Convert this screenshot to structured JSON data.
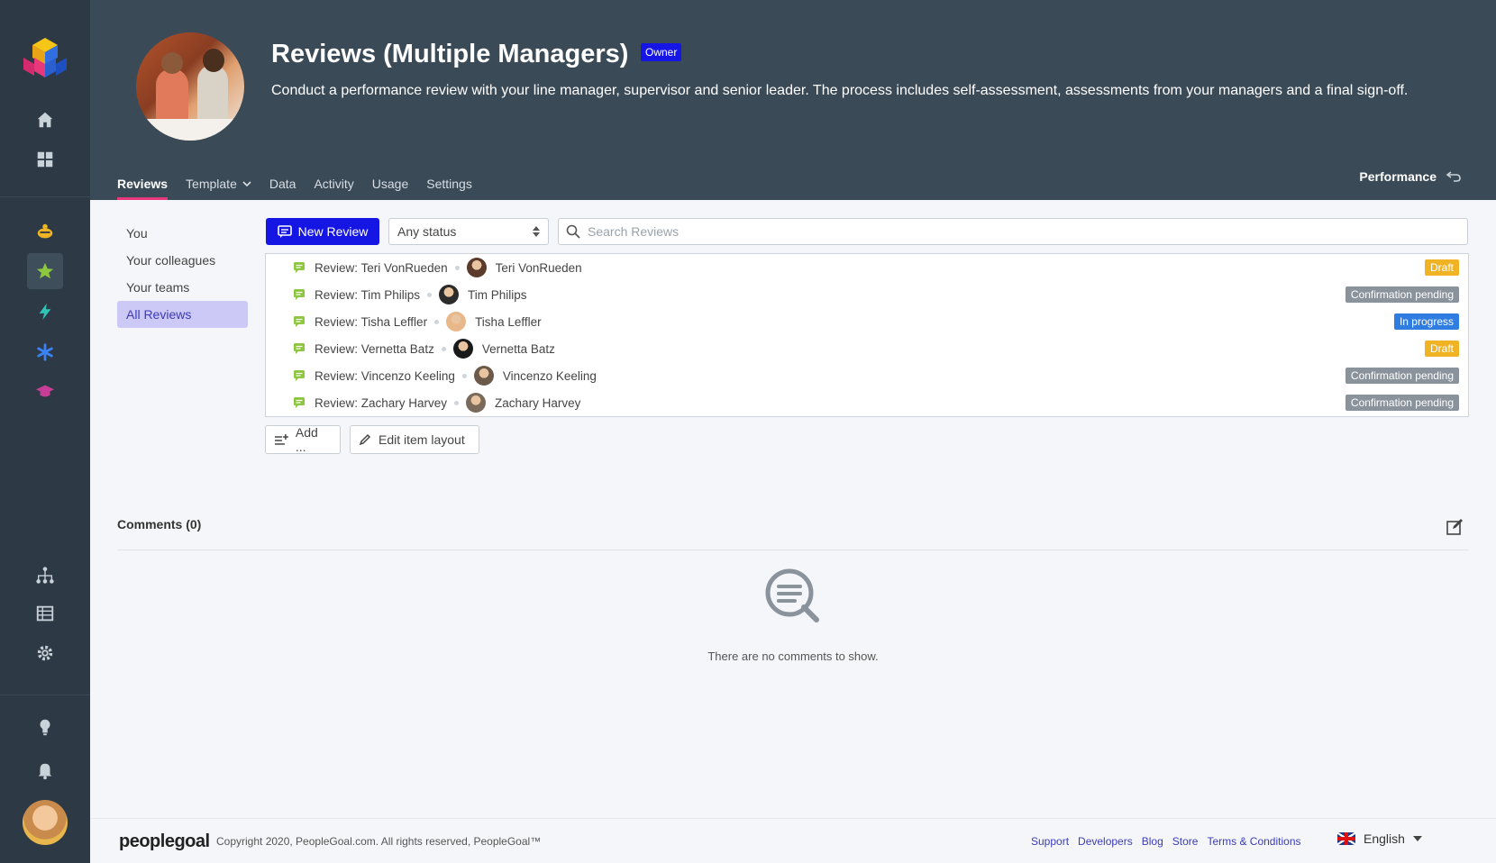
{
  "sidebar": {
    "icons": [
      "logo-icon",
      "home-icon",
      "apps-grid-icon",
      "bee-icon",
      "star-icon",
      "bolt-icon",
      "asterisk-icon",
      "graduation-cap-icon",
      "org-chart-icon",
      "table-icon",
      "gear-icon",
      "lightbulb-icon",
      "bell-icon"
    ],
    "colors": {
      "bg": "#2d3a46",
      "star": "#8dc63f",
      "bolt": "#2ec4b6",
      "asterisk": "#3b82f6",
      "cap": "#c83e96",
      "bee": "#f0b323"
    }
  },
  "header": {
    "title": "Reviews (Multiple Managers)",
    "owner_badge": "Owner",
    "description": "Conduct a performance review with your line manager, supervisor and senior leader. The process includes self-assessment, assessments from your managers and a final sign-off.",
    "tabs": [
      {
        "label": "Reviews",
        "active": true
      },
      {
        "label": "Template",
        "dropdown": true
      },
      {
        "label": "Data"
      },
      {
        "label": "Activity"
      },
      {
        "label": "Usage"
      },
      {
        "label": "Settings"
      }
    ],
    "performance_link": "Performance"
  },
  "subnav": {
    "items": [
      {
        "label": "You"
      },
      {
        "label": "Your colleagues"
      },
      {
        "label": "Your teams"
      },
      {
        "label": "All Reviews",
        "active": true
      }
    ]
  },
  "toolbar": {
    "new_review_label": "New Review",
    "status_select_value": "Any status",
    "search_placeholder": "Search Reviews"
  },
  "reviews": [
    {
      "title": "Review: Teri VonRueden",
      "person": "Teri VonRueden",
      "status": "Draft",
      "status_type": "draft",
      "avatar_color": "#5a3a2a"
    },
    {
      "title": "Review: Tim Philips",
      "person": "Tim Philips",
      "status": "Confirmation pending",
      "status_type": "pending",
      "avatar_color": "#2b2b2b"
    },
    {
      "title": "Review: Tisha Leffler",
      "person": "Tisha Leffler",
      "status": "In progress",
      "status_type": "progress",
      "avatar_color": "#e8b88a"
    },
    {
      "title": "Review: Vernetta Batz",
      "person": "Vernetta Batz",
      "status": "Draft",
      "status_type": "draft",
      "avatar_color": "#1a1a1a"
    },
    {
      "title": "Review: Vincenzo Keeling",
      "person": "Vincenzo Keeling",
      "status": "Confirmation pending",
      "status_type": "pending",
      "avatar_color": "#6b5a4a"
    },
    {
      "title": "Review: Zachary Harvey",
      "person": "Zachary Harvey",
      "status": "Confirmation pending",
      "status_type": "pending",
      "avatar_color": "#7a6a5a"
    }
  ],
  "list_actions": {
    "add_label": "Add ...",
    "edit_layout_label": "Edit item layout"
  },
  "comments": {
    "title": "Comments (0)",
    "empty_text": "There are no comments to show."
  },
  "footer": {
    "logo": "peoplegoal",
    "copyright": "Copyright 2020, PeopleGoal.com. All rights reserved, PeopleGoal™",
    "links": [
      "Support",
      "Developers",
      "Blog",
      "Store",
      "Terms & Conditions"
    ],
    "language": "English"
  }
}
